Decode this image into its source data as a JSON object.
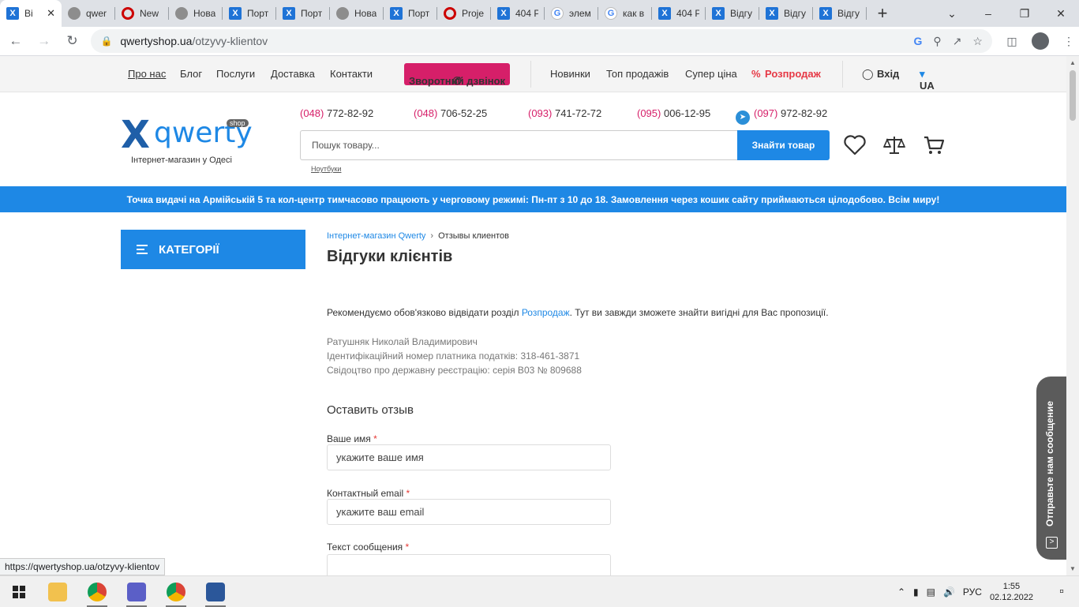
{
  "browser": {
    "tabs": [
      {
        "title": "Ві",
        "icon": "qwerty-favicon",
        "active": true
      },
      {
        "title": "qwer",
        "icon": "globe-icon"
      },
      {
        "title": "New",
        "icon": "red-circle-icon"
      },
      {
        "title": "Нова",
        "icon": "globe-icon"
      },
      {
        "title": "Порт",
        "icon": "qwerty-favicon"
      },
      {
        "title": "Порт",
        "icon": "qwerty-favicon"
      },
      {
        "title": "Нова",
        "icon": "globe-icon"
      },
      {
        "title": "Порт",
        "icon": "qwerty-favicon"
      },
      {
        "title": "Proje",
        "icon": "red-circle-icon"
      },
      {
        "title": "404 Р",
        "icon": "qwerty-favicon"
      },
      {
        "title": "элем",
        "icon": "google-icon"
      },
      {
        "title": "как в",
        "icon": "google-icon"
      },
      {
        "title": "404 Р",
        "icon": "qwerty-favicon"
      },
      {
        "title": "Відгу",
        "icon": "qwerty-favicon"
      },
      {
        "title": "Відгу",
        "icon": "qwerty-favicon"
      },
      {
        "title": "Відгу",
        "icon": "qwerty-favicon"
      }
    ],
    "url_host": "qwertyshop.ua",
    "url_path": "/otzyvy-klientov",
    "status_url": "https://qwertyshop.ua/otzyvy-klientov"
  },
  "topnav": {
    "about": "Про нас",
    "blog": "Блог",
    "services": "Послуги",
    "delivery": "Доставка",
    "contacts": "Контакти",
    "callback": "Зворотний дзвінок",
    "new": "Новинки",
    "top": "Топ продажів",
    "super": "Супер ціна",
    "sale": "Розпродаж",
    "login": "Вхід",
    "lang": "UA"
  },
  "header": {
    "logo_word": "qwerty",
    "logo_shop": "shop",
    "logo_tagline": "Інтернет-магазин у Одесі",
    "phones": [
      {
        "code": "(048)",
        "number": " 772-82-92"
      },
      {
        "code": "(048)",
        "number": " 706-52-25"
      },
      {
        "code": "(093)",
        "number": " 741-72-72"
      },
      {
        "code": "(095)",
        "number": " 006-12-95"
      },
      {
        "code": "(097)",
        "number": " 972-82-92"
      }
    ],
    "search_placeholder": "Пошук товару...",
    "search_button": "Знайти товар",
    "search_hint": "Ноутбуки"
  },
  "banner": "Точка видачі на Армійській 5 та кол-центр тимчасово працюють у черговому режимі: Пн-пт з 10 до 18. Замовлення через кошик сайту приймаються цілодобово. Всім миру!",
  "main": {
    "categories": "КАТЕГОРІЇ",
    "breadcrumb_home": "Інтернет-магазин Qwerty",
    "breadcrumb_current": "Отзывы клиентов",
    "title": "Відгуки клієнтів",
    "recommend_pre": "Рекомендуємо обов'язково відвідати розділ ",
    "recommend_link": "Розпродаж",
    "recommend_post": ". Тут ви завжди зможете знайти вигідні для Вас пропозиції.",
    "seller_name": "Ратушняк Николай Владимирович",
    "seller_tax": "Ідентифікаційний номер платника податків: 318-461-3871",
    "seller_cert": "Свідоцтво про державну реєстрацію: серія В03 № 809688",
    "form_title": "Оставить отзыв",
    "name_label": "Ваше имя",
    "name_placeholder": "укажите ваше имя",
    "email_label": "Контактный email",
    "email_placeholder": "укажите ваш email",
    "message_label": "Текст сообщения",
    "required_mark": "*"
  },
  "feedback_widget": "Отправьте нам сообщение",
  "taskbar": {
    "lang": "РУС",
    "time": "1:55",
    "date": "02.12.2022"
  },
  "colors": {
    "accent_blue": "#1e88e5",
    "accent_pink": "#d61f69",
    "sale_red": "#e63946"
  }
}
